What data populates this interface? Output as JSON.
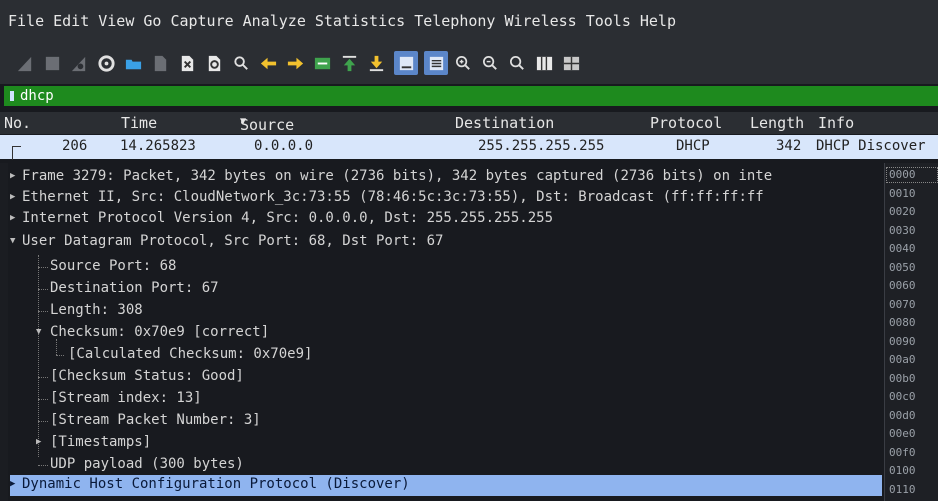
{
  "menu": [
    "File",
    "Edit",
    "View",
    "Go",
    "Capture",
    "Analyze",
    "Statistics",
    "Telephony",
    "Wireless",
    "Tools",
    "Help"
  ],
  "toolbar": {
    "icons": [
      "shark-fin-start-icon",
      "stop-square-icon",
      "shark-fin-restart-icon",
      "gear-options-icon",
      "folder-open-icon",
      "file-icon",
      "close-file-icon",
      "reload-icon",
      "search-icon",
      "arrow-left-icon",
      "arrow-right-icon",
      "go-to-packet-icon",
      "go-first-icon",
      "go-last-icon",
      "autoscroll-icon",
      "colorize-icon",
      "zoom-in-icon",
      "zoom-out-icon",
      "zoom-normal-icon",
      "resize-columns-icon",
      "layout-icon"
    ]
  },
  "filter": {
    "value": "dhcp"
  },
  "columns": {
    "no": "No.",
    "time": "Time",
    "source": "Source",
    "destination": "Destination",
    "protocol": "Protocol",
    "length": "Length",
    "info": "Info"
  },
  "packet": {
    "no": "206",
    "time": "14.265823",
    "source": "0.0.0.0",
    "destination": "255.255.255.255",
    "protocol": "DHCP",
    "length": "342",
    "info": "DHCP Discover"
  },
  "details": [
    {
      "text": "Frame 3279: Packet, 342 bytes on wire (2736 bits), 342 bytes captured (2736 bits) on inte",
      "arrow": "right"
    },
    {
      "text": "Ethernet II, Src: CloudNetwork_3c:73:55 (78:46:5c:3c:73:55), Dst: Broadcast (ff:ff:ff:ff",
      "arrow": "right"
    },
    {
      "text": "Internet Protocol Version 4, Src: 0.0.0.0, Dst: 255.255.255.255",
      "arrow": "right"
    },
    {
      "text": "User Datagram Protocol, Src Port: 68, Dst Port: 67",
      "arrow": "down"
    },
    {
      "text": "Source Port: 68",
      "arrow": ""
    },
    {
      "text": "Destination Port: 67",
      "arrow": ""
    },
    {
      "text": "Length: 308",
      "arrow": ""
    },
    {
      "text": "Checksum: 0x70e9 [correct]",
      "arrow": "down"
    },
    {
      "text": "[Calculated Checksum: 0x70e9]",
      "arrow": ""
    },
    {
      "text": "[Checksum Status: Good]",
      "arrow": ""
    },
    {
      "text": "[Stream index: 13]",
      "arrow": ""
    },
    {
      "text": "[Stream Packet Number: 3]",
      "arrow": ""
    },
    {
      "text": "[Timestamps]",
      "arrow": "right"
    },
    {
      "text": "UDP payload (300 bytes)",
      "arrow": ""
    },
    {
      "text": "Dynamic Host Configuration Protocol (Discover)",
      "arrow": "right"
    }
  ],
  "hex_offsets": [
    "0000",
    "0010",
    "0020",
    "0030",
    "0040",
    "0050",
    "0060",
    "0070",
    "0080",
    "0090",
    "00a0",
    "00b0",
    "00c0",
    "00d0",
    "00e0",
    "00f0",
    "0100",
    "0110"
  ]
}
